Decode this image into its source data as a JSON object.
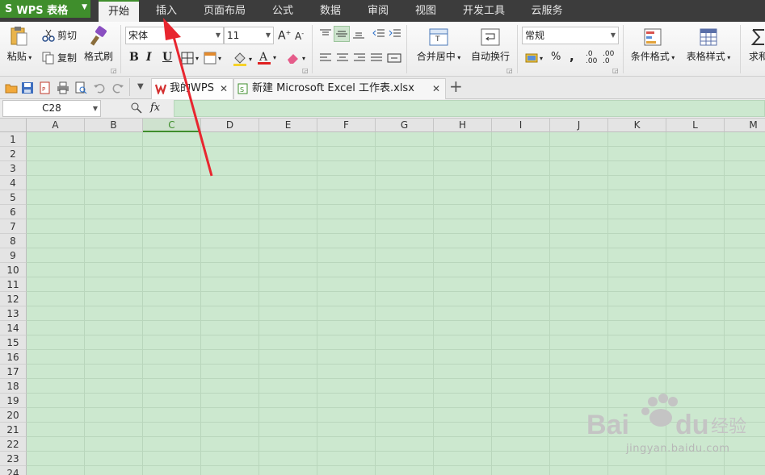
{
  "app": {
    "name": "WPS 表格",
    "logo": "S"
  },
  "menu": {
    "tabs": [
      {
        "label": "开始",
        "active": true
      },
      {
        "label": "插入",
        "active": false
      },
      {
        "label": "页面布局",
        "active": false
      },
      {
        "label": "公式",
        "active": false
      },
      {
        "label": "数据",
        "active": false
      },
      {
        "label": "审阅",
        "active": false
      },
      {
        "label": "视图",
        "active": false
      },
      {
        "label": "开发工具",
        "active": false
      },
      {
        "label": "云服务",
        "active": false
      }
    ]
  },
  "ribbon": {
    "paste": "粘贴",
    "cut": "剪切",
    "copy": "复制",
    "format_painter": "格式刷",
    "font_name": "宋体",
    "font_size": "11",
    "bold": "B",
    "italic": "I",
    "underline": "U",
    "merge_center": "合并居中",
    "wrap_text": "自动换行",
    "number_format": "常规",
    "percent": "%",
    "comma": ",",
    "cond_format": "条件格式",
    "table_style": "表格样式",
    "sum": "求和"
  },
  "tabs": {
    "home_doc": "我的WPS",
    "file_doc": "新建 Microsoft Excel 工作表.xlsx",
    "add": "+"
  },
  "formula_bar": {
    "cell_ref": "C28",
    "fx": "fx",
    "value": ""
  },
  "sheet": {
    "columns": [
      "A",
      "B",
      "C",
      "D",
      "E",
      "F",
      "G",
      "H",
      "I",
      "J",
      "K",
      "L",
      "M"
    ],
    "selected_column": "C",
    "rows": [
      "1",
      "2",
      "3",
      "4",
      "5",
      "6",
      "7",
      "8",
      "9",
      "10",
      "11",
      "12",
      "13",
      "14",
      "15",
      "16",
      "17",
      "18",
      "19",
      "20",
      "21",
      "22",
      "23",
      "24"
    ]
  },
  "watermark": {
    "brand": "Baidu经验",
    "url": "jingyan.baidu.com"
  },
  "colors": {
    "accent": "#3f8e2c",
    "menubar": "#3c3c3c",
    "cell_bg": "#cce8cf",
    "arrow": "#e8262f"
  }
}
